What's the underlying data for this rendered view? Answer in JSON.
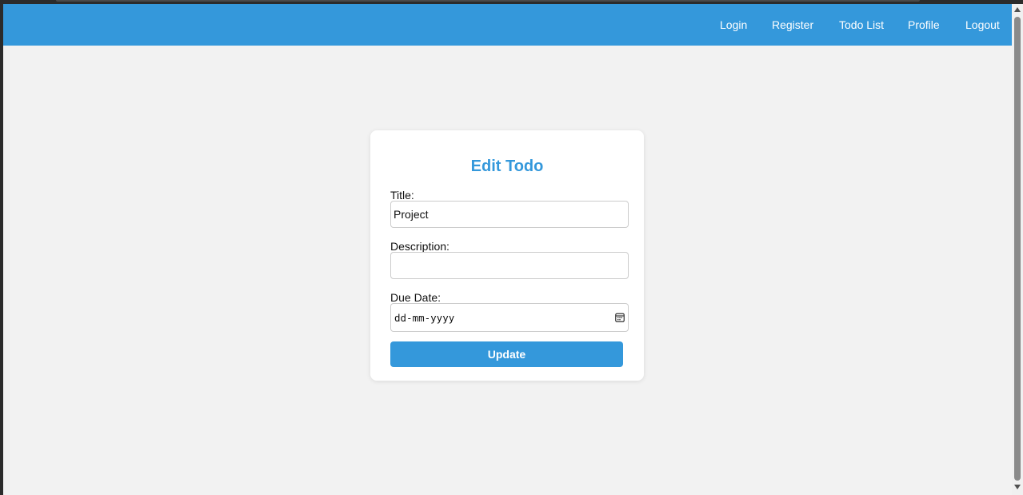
{
  "nav": {
    "links": [
      {
        "label": "Login"
      },
      {
        "label": "Register"
      },
      {
        "label": "Todo List"
      },
      {
        "label": "Profile"
      },
      {
        "label": "Logout"
      }
    ]
  },
  "form": {
    "title": "Edit Todo",
    "title_label": "Title:",
    "title_value": "Project",
    "description_label": "Description:",
    "description_value": "",
    "due_date_label": "Due Date:",
    "due_date_placeholder": "dd-mm-yyyy",
    "submit_label": "Update"
  },
  "icons": {
    "calendar": "calendar-icon"
  },
  "colors": {
    "accent": "#3498db",
    "page_background": "#f2f2f2",
    "card_background": "#ffffff"
  }
}
